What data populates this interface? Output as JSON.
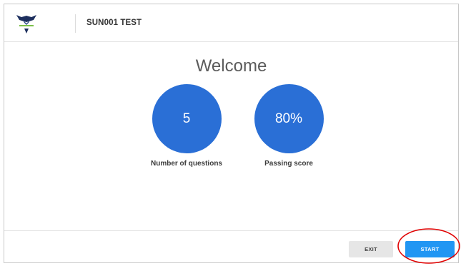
{
  "header": {
    "title": "SUN001 TEST",
    "logo_icon": "eagle-logo-icon"
  },
  "main": {
    "heading": "Welcome",
    "stats": [
      {
        "value": "5",
        "label": "Number of questions"
      },
      {
        "value": "80%",
        "label": "Passing score"
      }
    ]
  },
  "footer": {
    "exit_label": "EXIT",
    "start_label": "START"
  },
  "colors": {
    "circle": "#2a6fd6",
    "start_button": "#2196f3",
    "exit_button": "#e6e6e6",
    "annotation": "#e00000"
  }
}
